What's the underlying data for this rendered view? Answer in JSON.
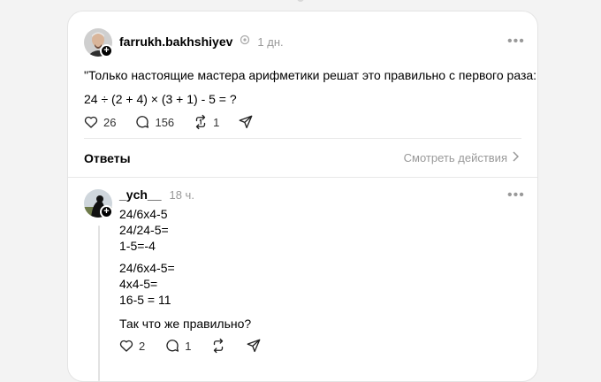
{
  "post": {
    "username": "farrukh.bakhshiyev",
    "time": "1 дн.",
    "text_line1": "\"Только настоящие мастера арифметики решат это правильно с первого раза:",
    "text_line2": "24 ÷ (2 + 4) × (3 + 1) - 5 = ?",
    "likes": "26",
    "comments": "156",
    "reposts": "1"
  },
  "answers_bar": {
    "label": "Ответы",
    "view_actions": "Смотреть действия"
  },
  "reply": {
    "username": "_ych__",
    "time": "18 ч.",
    "lines": [
      "24/6x4-5",
      "24/24-5=",
      "1-5=-4",
      "24/6x4-5=",
      "4x4-5=",
      "16-5 = 11",
      "Так что же правильно?"
    ],
    "likes": "2",
    "comments": "1"
  },
  "colors": {
    "text": "#000000",
    "muted": "#999999",
    "card": "#ffffff",
    "page": "#f3f3f3"
  }
}
